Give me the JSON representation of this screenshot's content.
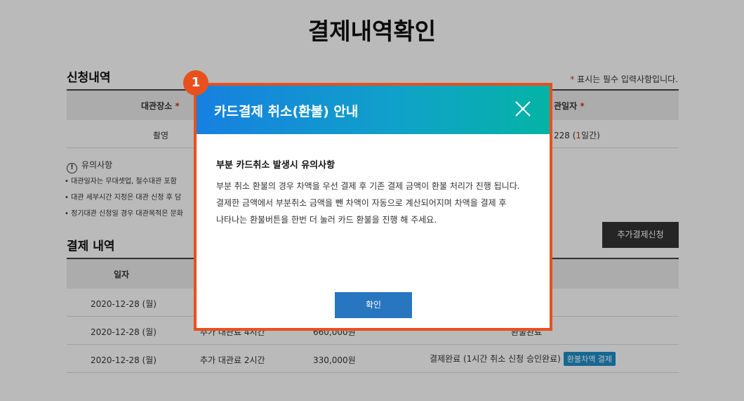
{
  "page_title": "결제내역확인",
  "application": {
    "section_title": "신청내역",
    "required_note_star": "*",
    "required_note_text": " 표시는 필수 입력사항입니다.",
    "header": {
      "venue_label": "대관장소",
      "date_label": "관일자",
      "star": "*"
    },
    "row": {
      "venue": "촬영",
      "date": "228 (",
      "days_red": "1",
      "days_suffix": "일간)"
    }
  },
  "notice": {
    "icon_glyph": "!",
    "title": "유의사항",
    "items": [
      "• 대관일자는 무대셋업, 철수대관 포함",
      "• 대관 세부시간 지정은 대관 신청 후 담",
      "• 정기대관 신청일 경우 대관목적은 문화"
    ]
  },
  "payment": {
    "section_title": "결제 내역",
    "add_button": "추가결제신청",
    "col_date": "일자",
    "rows": [
      {
        "date": "2020-12-28 (월)",
        "item": "",
        "amount": "",
        "status": "",
        "badge": ""
      },
      {
        "date": "2020-12-28 (월)",
        "item": "추가 대관료 4시간",
        "amount": "660,000원",
        "status": "환불완료",
        "badge": ""
      },
      {
        "date": "2020-12-28 (월)",
        "item": "추가 대관료 2시간",
        "amount": "330,000원",
        "status": "결제완료 (1시간 취소 신청 승인완료)",
        "badge": "환불차액 결제"
      }
    ]
  },
  "modal": {
    "step_number": "1",
    "title": "카드결제 취소(환불) 안내",
    "close_icon": "close-icon",
    "body_title": "부분 카드취소 발생시 유의사항",
    "body_lines": [
      "부분 취소 환불의 경우 차액을 우선 결제 후 기존 결제 금액이 환불 처리가 진행 됩니다.",
      "결제한 금액에서 부분취소 금액을 뺀 차액이 자동으로 계산되어지며 차액을 결제 후",
      "나타나는 환불버튼을 한번 더 눌러 카드 환불을 진행 해 주세요."
    ],
    "confirm_button": "확인"
  },
  "colors": {
    "accent_orange": "#e8501e",
    "header_gradient_start": "#1680e0",
    "header_gradient_end": "#04b3a5",
    "button_blue": "#2875c0",
    "badge_blue": "#1f8fc9",
    "required_red": "#c0392b"
  }
}
